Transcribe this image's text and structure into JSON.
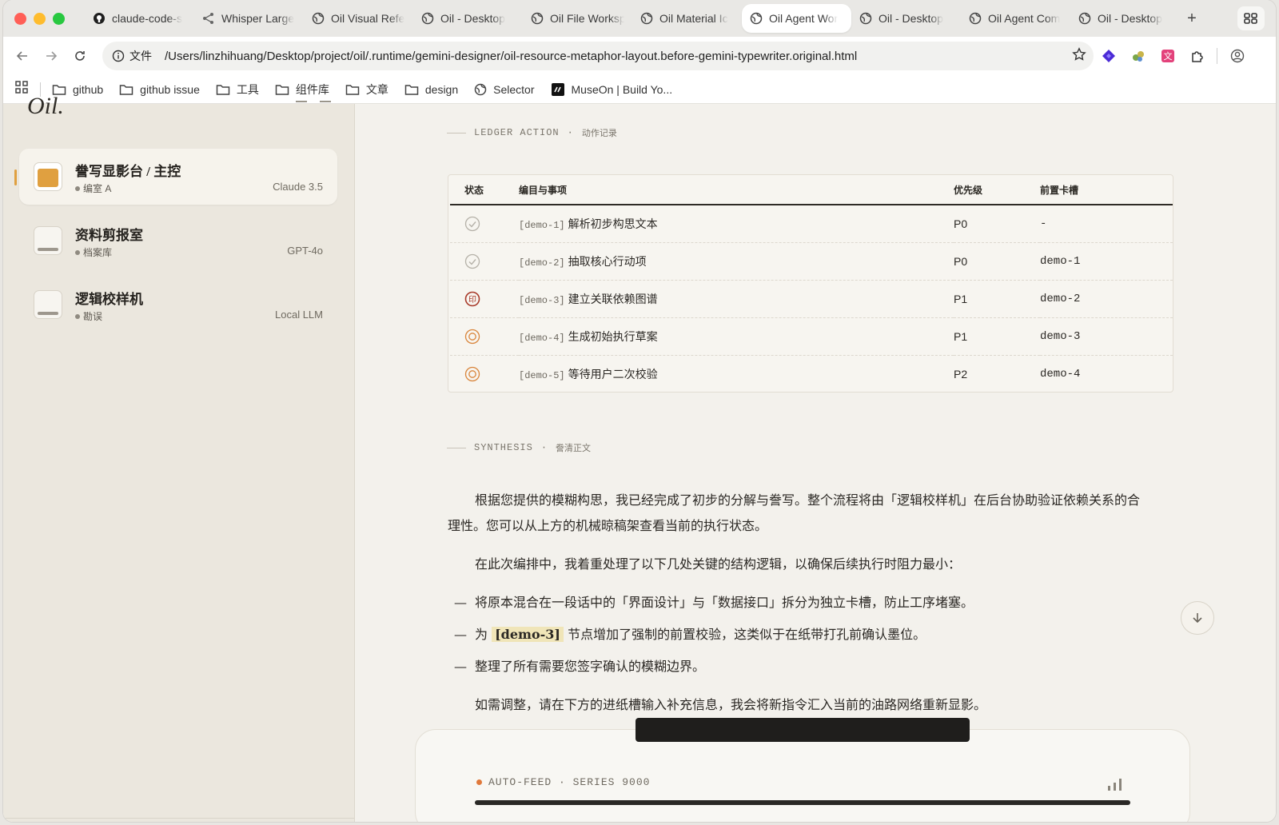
{
  "browser": {
    "tabs": [
      {
        "label": "claude-code-s",
        "icon": "github-icon",
        "active": false
      },
      {
        "label": "Whisper Large",
        "icon": "share-icon",
        "active": false
      },
      {
        "label": "Oil Visual Refe",
        "icon": "globe-icon",
        "active": false
      },
      {
        "label": "Oil - Desktop",
        "icon": "globe-icon",
        "active": false
      },
      {
        "label": "Oil File Worksp",
        "icon": "globe-icon",
        "active": false
      },
      {
        "label": "Oil Material Ic",
        "icon": "globe-icon",
        "active": false
      },
      {
        "label": "Oil Agent Wor",
        "icon": "globe-icon",
        "active": true
      },
      {
        "label": "Oil - Desktop",
        "icon": "globe-icon",
        "active": false
      },
      {
        "label": "Oil Agent Com",
        "icon": "globe-icon",
        "active": false
      },
      {
        "label": "Oil - Desktop",
        "icon": "globe-icon",
        "active": false
      }
    ],
    "new_tab": "+",
    "url_badge": "文件",
    "url": "/Users/linzhihuang/Desktop/project/oil/.runtime/gemini-designer/oil-resource-metaphor-layout.before-gemini-typewriter.original.html",
    "bookmarks": [
      {
        "label": "github",
        "icon": "folder-icon"
      },
      {
        "label": "github issue",
        "icon": "folder-icon"
      },
      {
        "label": "工具",
        "icon": "folder-icon"
      },
      {
        "label": "组件库",
        "icon": "folder-icon"
      },
      {
        "label": "文章",
        "icon": "folder-icon"
      },
      {
        "label": "design",
        "icon": "folder-icon"
      },
      {
        "label": "Selector",
        "icon": "globe-icon"
      },
      {
        "label": "MuseOn | Build Yo...",
        "icon": "museon-icon"
      }
    ]
  },
  "sidebar": {
    "logo": "Oil.",
    "items": [
      {
        "title": "誊写显影台 / 主控",
        "sub": "编室 A",
        "model": "Claude 3.5",
        "active": true
      },
      {
        "title": "资料剪报室",
        "sub": "档案库",
        "model": "GPT-4o",
        "active": false
      },
      {
        "title": "逻辑校样机",
        "sub": "勘误",
        "model": "Local LLM",
        "active": false
      }
    ]
  },
  "ledger": {
    "label": "LEDGER ACTION",
    "label_sep": "·",
    "label_zh": "动作记录",
    "headers": {
      "status": "状态",
      "item": "编目与事项",
      "priority": "优先级",
      "dep": "前置卡槽"
    },
    "rows": [
      {
        "status": "done",
        "id": "[demo-1]",
        "title": "解析初步构思文本",
        "priority": "P0",
        "dep": "-"
      },
      {
        "status": "done",
        "id": "[demo-2]",
        "title": "抽取核心行动项",
        "priority": "P0",
        "dep": "demo-1"
      },
      {
        "status": "stamped",
        "id": "[demo-3]",
        "title": "建立关联依赖图谱",
        "priority": "P1",
        "dep": "demo-2"
      },
      {
        "status": "pending",
        "id": "[demo-4]",
        "title": "生成初始执行草案",
        "priority": "P1",
        "dep": "demo-3"
      },
      {
        "status": "pending",
        "id": "[demo-5]",
        "title": "等待用户二次校验",
        "priority": "P2",
        "dep": "demo-4"
      }
    ],
    "stamp_char": "印",
    "colors": {
      "done": "#b5b1a8",
      "stamped": "#a83a2a",
      "pending": "#d9853b"
    }
  },
  "synthesis": {
    "label": "SYNTHESIS",
    "label_sep": "·",
    "label_zh": "誊清正文",
    "p1": "根据您提供的模糊构思，我已经完成了初步的分解与誊写。整个流程将由「逻辑校样机」在后台协助验证依赖关系的合理性。您可以从上方的机械晾稿架查看当前的执行状态。",
    "p2": "在此次编排中，我着重处理了以下几处关键的结构逻辑，以确保后续执行时阻力最小：",
    "dash": "—",
    "li1": "将原本混合在一段话中的「界面设计」与「数据接口」拆分为独立卡槽，防止工序堵塞。",
    "li2_pre": "为",
    "li2_hl": "[demo-3]",
    "li2_post": "节点增加了强制的前置校验，这类似于在纸带打孔前确认墨位。",
    "li3": "整理了所有需要您签字确认的模糊边界。",
    "p3": "如需调整，请在下方的进纸槽输入补充信息，我会将新指令汇入当前的油路网络重新显影。"
  },
  "feed": {
    "label": "AUTO-FEED · SERIES 9000",
    "dot_color": "#e0783a"
  }
}
